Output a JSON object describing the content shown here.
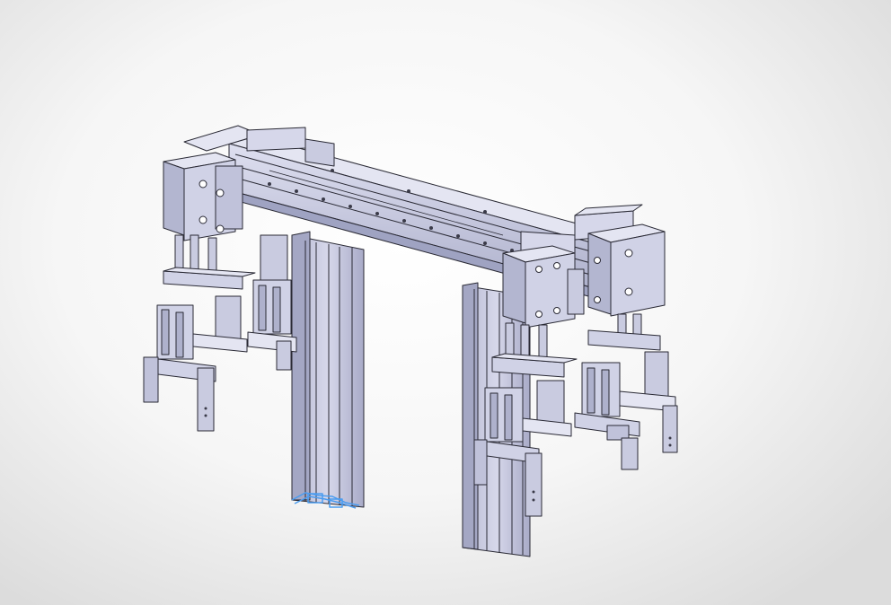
{
  "viewport": {
    "background": "#f2f2f2",
    "model": {
      "part_fill": "#c9cbe0",
      "part_dark": "#9fa3c2",
      "part_light": "#e4e5f2",
      "edge_color": "#2a2a35",
      "selection_color": "#4a9cf0"
    }
  }
}
